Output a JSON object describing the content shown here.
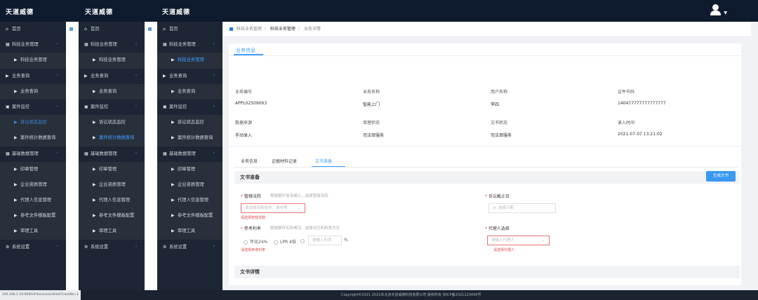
{
  "app": {
    "brand": "天道威德"
  },
  "menu": [
    {
      "key": "home",
      "label": "首页",
      "kind": "group",
      "icon": "home-icon",
      "chev": false
    },
    {
      "key": "biz-mgmt",
      "label": "科技业务管理",
      "kind": "group",
      "icon": "grid-icon",
      "chev": true
    },
    {
      "key": "biz-mgmt-sub",
      "label": "科技业务管理",
      "kind": "sub",
      "icon": "play-icon"
    },
    {
      "key": "biz-query",
      "label": "业务查询",
      "kind": "group",
      "icon": "play-icon",
      "chev": true
    },
    {
      "key": "biz-query-sub",
      "label": "业务查询",
      "kind": "sub",
      "icon": "play-icon"
    },
    {
      "key": "monitor",
      "label": "案件监控",
      "kind": "group",
      "icon": "monitor-icon",
      "chev": true
    },
    {
      "key": "monitor-1",
      "label": "诉讼状态监控",
      "kind": "sub",
      "icon": "play-icon"
    },
    {
      "key": "monitor-2",
      "label": "案件统计数据查询",
      "kind": "sub",
      "icon": "play-icon"
    },
    {
      "key": "basedata",
      "label": "基础数据管理",
      "kind": "group",
      "icon": "grid-icon",
      "chev": true
    },
    {
      "key": "bd-1",
      "label": "印章管理",
      "kind": "sub",
      "icon": "play-icon"
    },
    {
      "key": "bd-2",
      "label": "企业资质管理",
      "kind": "sub",
      "icon": "play-icon"
    },
    {
      "key": "bd-3",
      "label": "代理人信息管理",
      "kind": "sub",
      "icon": "play-icon"
    },
    {
      "key": "bd-4",
      "label": "参考文件模板配置",
      "kind": "sub",
      "icon": "play-icon"
    },
    {
      "key": "bd-5",
      "label": "审理工具",
      "kind": "sub",
      "icon": "play-icon"
    },
    {
      "key": "system",
      "label": "系统设置",
      "kind": "group",
      "icon": "gear-icon",
      "chev": true
    }
  ],
  "breadcrumb": {
    "items": [
      "科技业务管理",
      "科技业务管理",
      "业务详情"
    ],
    "current_index": 1
  },
  "card": {
    "tab_label": "业务信息"
  },
  "info_fields": [
    {
      "label": "业务编号",
      "value": "APPL02509063"
    },
    {
      "label": "业务名称",
      "value": "智能上门"
    },
    {
      "label": "用户名称",
      "value": "李四"
    },
    {
      "label": "证件号码",
      "value": "140477777777777777"
    },
    {
      "label": "数据来源",
      "value": "手动录入"
    },
    {
      "label": "审理状态",
      "value": "司法审服务"
    },
    {
      "label": "文书状态",
      "value": "司法审服务"
    },
    {
      "label": "录入时间",
      "value": "2021-07-07 13:21:02"
    }
  ],
  "detail_tabs": [
    "业务信息",
    "证据材料记录",
    "文书准备"
  ],
  "active_detail_tab": 2,
  "section_doc": {
    "title": "文书准备",
    "button": "生成文书"
  },
  "form": {
    "court": {
      "label": "管辖法院",
      "hint": "根据案件信息确认，选择管辖法院",
      "placeholder": "请选择法院省份、城市等",
      "error": "请选择管辖法院"
    },
    "deadline": {
      "label": "诉讼截止日",
      "placeholder": "选择日期"
    },
    "rate": {
      "label": "参考利率",
      "hint": "根据案件实际情况，选择对应的利率方式",
      "error": "请选择参考利率",
      "options": [
        "年化24%",
        "LPR 4倍",
        ""
      ],
      "input_placeholder": "请输入利率",
      "suffix": "%"
    },
    "agent": {
      "label": "代理人选择",
      "placeholder": "请输入代理人",
      "error": "请选择代理人"
    }
  },
  "section_detail": {
    "title": "文书详情"
  },
  "footer": {
    "copyright": "Copyright©2021 2021年北京天道威德科技有限公司 版权所有 京ICP备2021123456号"
  },
  "status_url": "192.168.1.10:8080/#/business/detail?caseNo=1"
}
